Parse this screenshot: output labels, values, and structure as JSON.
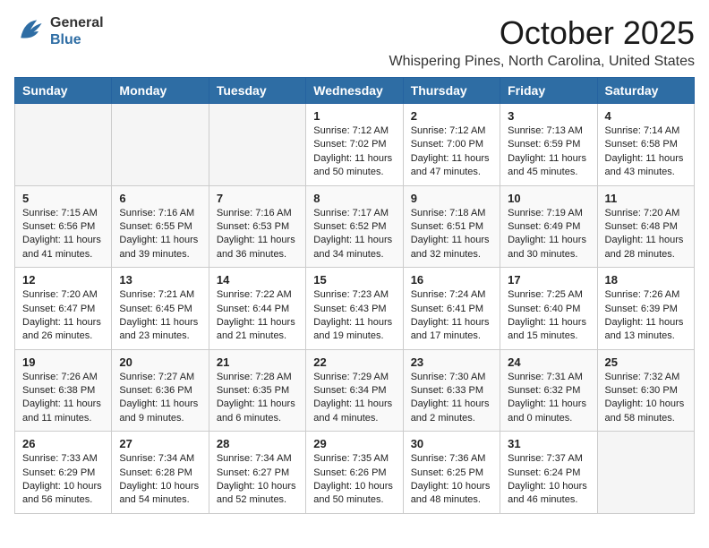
{
  "logo": {
    "line1": "General",
    "line2": "Blue"
  },
  "title": "October 2025",
  "location": "Whispering Pines, North Carolina, United States",
  "weekdays": [
    "Sunday",
    "Monday",
    "Tuesday",
    "Wednesday",
    "Thursday",
    "Friday",
    "Saturday"
  ],
  "weeks": [
    [
      {
        "day": "",
        "info": ""
      },
      {
        "day": "",
        "info": ""
      },
      {
        "day": "",
        "info": ""
      },
      {
        "day": "1",
        "info": "Sunrise: 7:12 AM\nSunset: 7:02 PM\nDaylight: 11 hours and 50 minutes."
      },
      {
        "day": "2",
        "info": "Sunrise: 7:12 AM\nSunset: 7:00 PM\nDaylight: 11 hours and 47 minutes."
      },
      {
        "day": "3",
        "info": "Sunrise: 7:13 AM\nSunset: 6:59 PM\nDaylight: 11 hours and 45 minutes."
      },
      {
        "day": "4",
        "info": "Sunrise: 7:14 AM\nSunset: 6:58 PM\nDaylight: 11 hours and 43 minutes."
      }
    ],
    [
      {
        "day": "5",
        "info": "Sunrise: 7:15 AM\nSunset: 6:56 PM\nDaylight: 11 hours and 41 minutes."
      },
      {
        "day": "6",
        "info": "Sunrise: 7:16 AM\nSunset: 6:55 PM\nDaylight: 11 hours and 39 minutes."
      },
      {
        "day": "7",
        "info": "Sunrise: 7:16 AM\nSunset: 6:53 PM\nDaylight: 11 hours and 36 minutes."
      },
      {
        "day": "8",
        "info": "Sunrise: 7:17 AM\nSunset: 6:52 PM\nDaylight: 11 hours and 34 minutes."
      },
      {
        "day": "9",
        "info": "Sunrise: 7:18 AM\nSunset: 6:51 PM\nDaylight: 11 hours and 32 minutes."
      },
      {
        "day": "10",
        "info": "Sunrise: 7:19 AM\nSunset: 6:49 PM\nDaylight: 11 hours and 30 minutes."
      },
      {
        "day": "11",
        "info": "Sunrise: 7:20 AM\nSunset: 6:48 PM\nDaylight: 11 hours and 28 minutes."
      }
    ],
    [
      {
        "day": "12",
        "info": "Sunrise: 7:20 AM\nSunset: 6:47 PM\nDaylight: 11 hours and 26 minutes."
      },
      {
        "day": "13",
        "info": "Sunrise: 7:21 AM\nSunset: 6:45 PM\nDaylight: 11 hours and 23 minutes."
      },
      {
        "day": "14",
        "info": "Sunrise: 7:22 AM\nSunset: 6:44 PM\nDaylight: 11 hours and 21 minutes."
      },
      {
        "day": "15",
        "info": "Sunrise: 7:23 AM\nSunset: 6:43 PM\nDaylight: 11 hours and 19 minutes."
      },
      {
        "day": "16",
        "info": "Sunrise: 7:24 AM\nSunset: 6:41 PM\nDaylight: 11 hours and 17 minutes."
      },
      {
        "day": "17",
        "info": "Sunrise: 7:25 AM\nSunset: 6:40 PM\nDaylight: 11 hours and 15 minutes."
      },
      {
        "day": "18",
        "info": "Sunrise: 7:26 AM\nSunset: 6:39 PM\nDaylight: 11 hours and 13 minutes."
      }
    ],
    [
      {
        "day": "19",
        "info": "Sunrise: 7:26 AM\nSunset: 6:38 PM\nDaylight: 11 hours and 11 minutes."
      },
      {
        "day": "20",
        "info": "Sunrise: 7:27 AM\nSunset: 6:36 PM\nDaylight: 11 hours and 9 minutes."
      },
      {
        "day": "21",
        "info": "Sunrise: 7:28 AM\nSunset: 6:35 PM\nDaylight: 11 hours and 6 minutes."
      },
      {
        "day": "22",
        "info": "Sunrise: 7:29 AM\nSunset: 6:34 PM\nDaylight: 11 hours and 4 minutes."
      },
      {
        "day": "23",
        "info": "Sunrise: 7:30 AM\nSunset: 6:33 PM\nDaylight: 11 hours and 2 minutes."
      },
      {
        "day": "24",
        "info": "Sunrise: 7:31 AM\nSunset: 6:32 PM\nDaylight: 11 hours and 0 minutes."
      },
      {
        "day": "25",
        "info": "Sunrise: 7:32 AM\nSunset: 6:30 PM\nDaylight: 10 hours and 58 minutes."
      }
    ],
    [
      {
        "day": "26",
        "info": "Sunrise: 7:33 AM\nSunset: 6:29 PM\nDaylight: 10 hours and 56 minutes."
      },
      {
        "day": "27",
        "info": "Sunrise: 7:34 AM\nSunset: 6:28 PM\nDaylight: 10 hours and 54 minutes."
      },
      {
        "day": "28",
        "info": "Sunrise: 7:34 AM\nSunset: 6:27 PM\nDaylight: 10 hours and 52 minutes."
      },
      {
        "day": "29",
        "info": "Sunrise: 7:35 AM\nSunset: 6:26 PM\nDaylight: 10 hours and 50 minutes."
      },
      {
        "day": "30",
        "info": "Sunrise: 7:36 AM\nSunset: 6:25 PM\nDaylight: 10 hours and 48 minutes."
      },
      {
        "day": "31",
        "info": "Sunrise: 7:37 AM\nSunset: 6:24 PM\nDaylight: 10 hours and 46 minutes."
      },
      {
        "day": "",
        "info": ""
      }
    ]
  ],
  "empty_first_days": 3,
  "accent_color": "#2e6da4"
}
